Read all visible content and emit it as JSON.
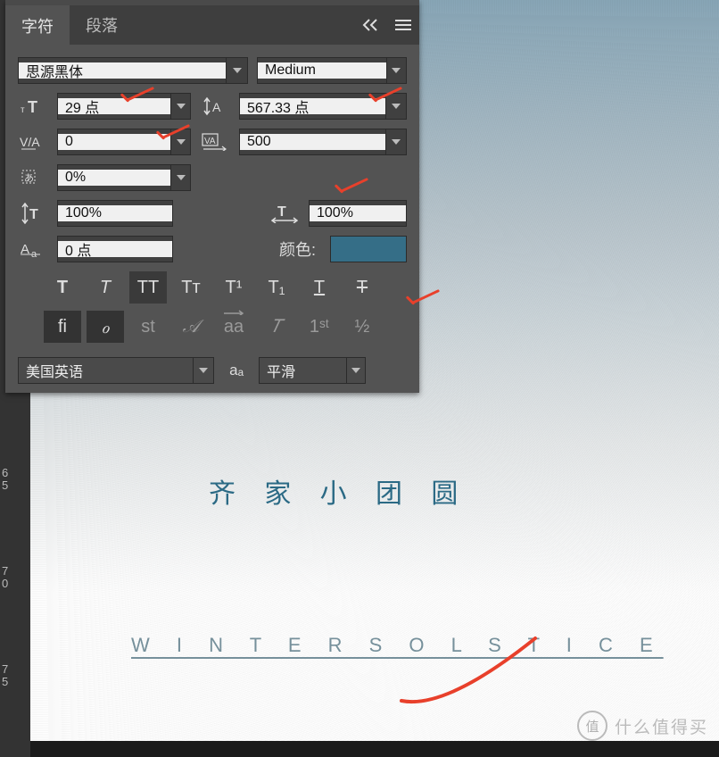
{
  "tabs": {
    "char": "字符",
    "para": "段落"
  },
  "font": {
    "family": "思源黑体",
    "style": "Medium"
  },
  "size": {
    "value": "29 点"
  },
  "leading": {
    "value": "567.33 点"
  },
  "kerning": {
    "value": "0"
  },
  "tracking": {
    "value": "500"
  },
  "tsume": {
    "value": "0%"
  },
  "vscale": {
    "value": "100%"
  },
  "hscale": {
    "value": "100%"
  },
  "baseline": {
    "value": "0 点"
  },
  "color": {
    "label": "颜色:",
    "hex": "#356e87"
  },
  "styleButtons": {
    "bold": "T",
    "italic": "T",
    "allcaps": "TT",
    "smallcaps": "Tᴛ",
    "superscript": "T¹",
    "subscript": "T₁",
    "underline": "T",
    "strike": "T"
  },
  "otRow": {
    "fi": "fi",
    "swash": "ℴ",
    "st": "st",
    "alt": "𝒜",
    "aa": "aa",
    "titling": "𝑇",
    "ord": "1ˢᵗ",
    "frac": "½"
  },
  "language": {
    "value": "美国英语"
  },
  "aa": {
    "label": "aₐ",
    "value": "平滑"
  },
  "canvas": {
    "line1": "齐 家 小 团 圆",
    "line2": "W I N T E R  S O L S T I C E"
  },
  "ruler": {
    "t65a": "6",
    "t65b": "5",
    "t70a": "7",
    "t70b": "0",
    "t75a": "7",
    "t75b": "5"
  },
  "watermark": {
    "badge": "值",
    "text": "什么值得买"
  }
}
